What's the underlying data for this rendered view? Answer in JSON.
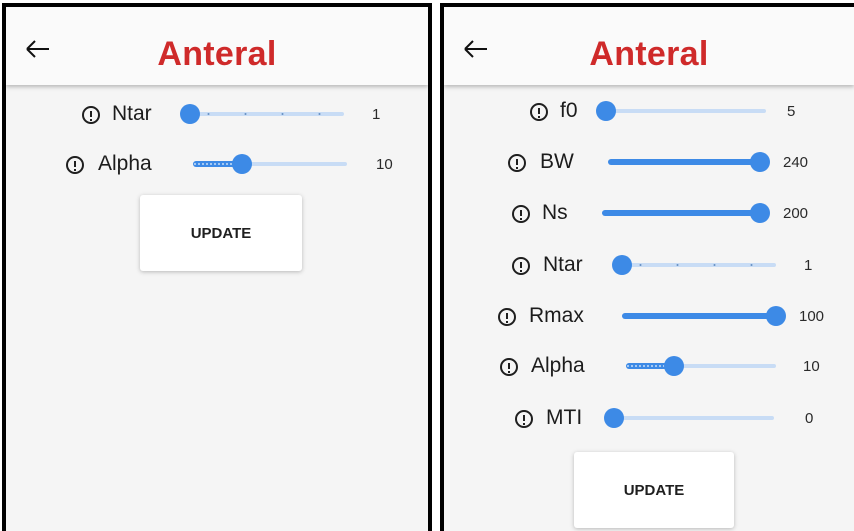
{
  "colors": {
    "title": "#cf2a2a",
    "accent": "#3d8ae6",
    "rail": "#c8dcf5"
  },
  "screens": [
    {
      "title": "Anteral",
      "back_icon": "arrow-left-icon",
      "update_label": "UPDATE",
      "params": [
        {
          "label": "Ntar",
          "value": "1",
          "fraction": 0.0,
          "stepped": true
        },
        {
          "label": "Alpha",
          "value": "10",
          "fraction": 0.32,
          "dotted": true
        }
      ]
    },
    {
      "title": "Anteral",
      "back_icon": "arrow-left-icon",
      "update_label": "UPDATE",
      "params": [
        {
          "label": "f0",
          "value": "5",
          "fraction": 0.0
        },
        {
          "label": "BW",
          "value": "240",
          "fraction": 1.0
        },
        {
          "label": "Ns",
          "value": "200",
          "fraction": 1.0
        },
        {
          "label": "Ntar",
          "value": "1",
          "fraction": 0.0,
          "stepped": true
        },
        {
          "label": "Rmax",
          "value": "100",
          "fraction": 1.0
        },
        {
          "label": "Alpha",
          "value": "10",
          "fraction": 0.32,
          "dotted": true
        },
        {
          "label": "MTI",
          "value": "0",
          "fraction": 0.0
        }
      ]
    }
  ]
}
